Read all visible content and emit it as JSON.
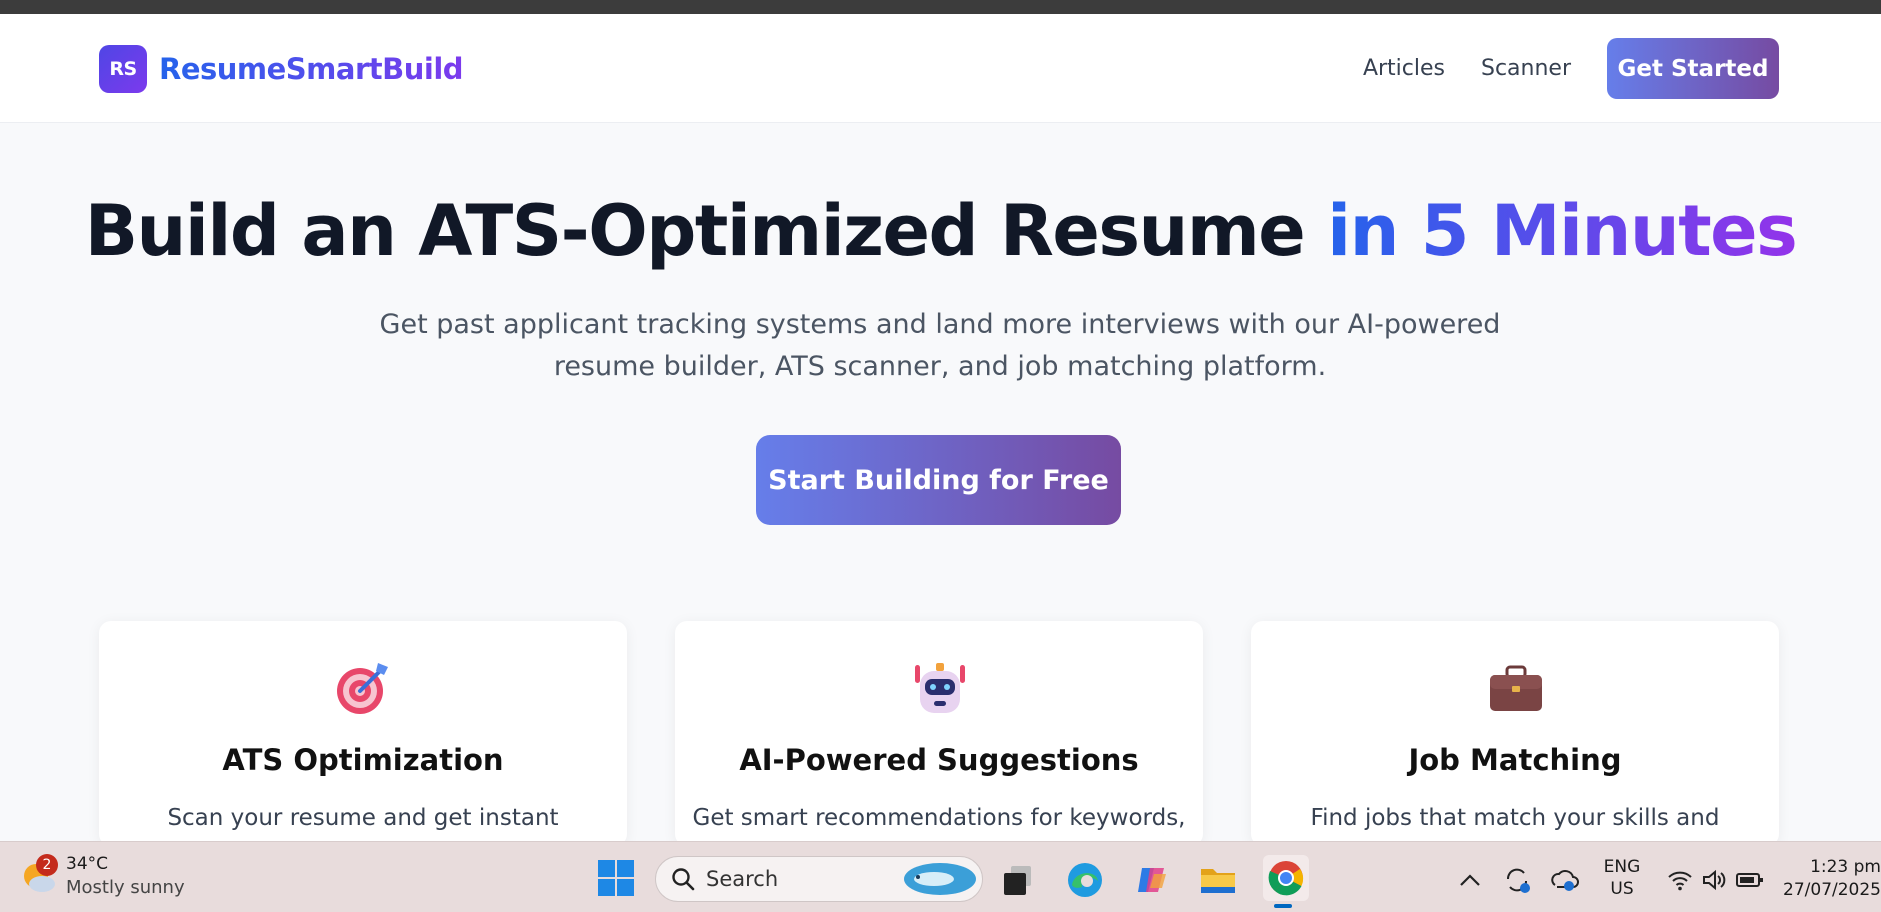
{
  "brand": {
    "badge": "RS",
    "name": "ResumeSmartBuild"
  },
  "nav": {
    "links": [
      "Articles",
      "Scanner"
    ],
    "cta": "Get Started"
  },
  "hero": {
    "title_main": "Build an ATS-Optimized Resume ",
    "title_accent": "in 5 Minutes",
    "subtitle_line1": "Get past applicant tracking systems and land more interviews with our AI-powered",
    "subtitle_line2": "resume builder, ATS scanner, and job matching platform.",
    "cta": "Start Building for Free"
  },
  "features": [
    {
      "icon": "target-icon",
      "title": "ATS Optimization",
      "text": "Scan your resume and get instant"
    },
    {
      "icon": "robot-icon",
      "title": "AI-Powered Suggestions",
      "text": "Get smart recommendations for keywords,"
    },
    {
      "icon": "briefcase-icon",
      "title": "Job Matching",
      "text": "Find jobs that match your skills and"
    }
  ],
  "taskbar": {
    "weather": {
      "badge": "2",
      "temp": "34°C",
      "desc": "Mostly sunny"
    },
    "search_placeholder": "Search",
    "lang_line1": "ENG",
    "lang_line2": "US",
    "time": "1:23 pm",
    "date": "27/07/2025"
  },
  "colors": {
    "brand_gradient_start": "#667eea",
    "brand_gradient_end": "#764ba2",
    "accent_blue": "#2563eb",
    "accent_purple": "#9333ea"
  }
}
